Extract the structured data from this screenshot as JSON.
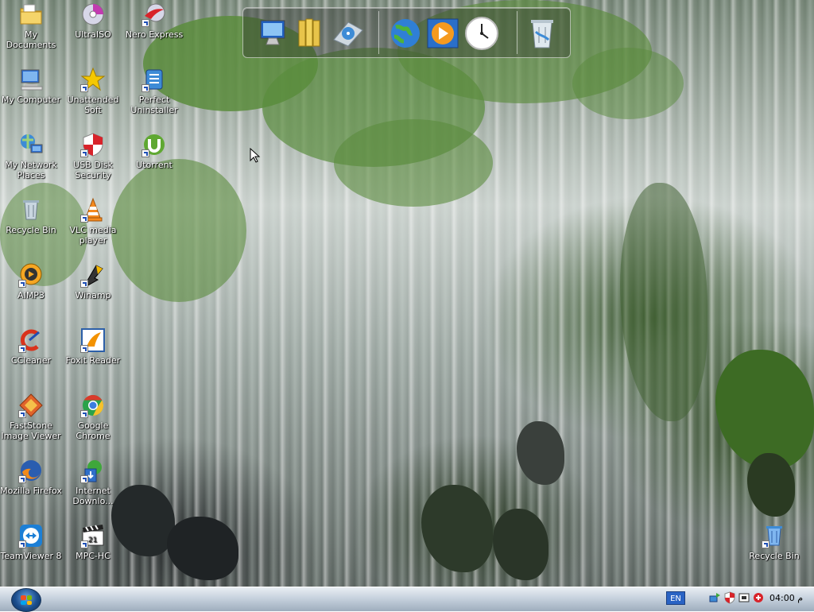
{
  "desktop_icons": [
    {
      "id": "my-documents",
      "label": "My Documents"
    },
    {
      "id": "ultraiso",
      "label": "UltraISO"
    },
    {
      "id": "nero-express",
      "label": "Nero Express"
    },
    {
      "id": "my-computer",
      "label": "My Computer"
    },
    {
      "id": "unattended-soft",
      "label": "Unattended Soft"
    },
    {
      "id": "perfect-uninstaller",
      "label": "Perfect Uninstaller"
    },
    {
      "id": "my-network-places",
      "label": "My Network Places"
    },
    {
      "id": "usb-disk-security",
      "label": "USB Disk Security"
    },
    {
      "id": "utorrent",
      "label": "Utorrent"
    },
    {
      "id": "recycle-bin",
      "label": "Recycle Bin"
    },
    {
      "id": "vlc-media-player",
      "label": "VLC media player"
    },
    {
      "id": "aimp3",
      "label": "AIMP3"
    },
    {
      "id": "winamp",
      "label": "Winamp"
    },
    {
      "id": "ccleaner",
      "label": "CCleaner"
    },
    {
      "id": "foxit-reader",
      "label": "Foxit Reader"
    },
    {
      "id": "faststone-image-viewer",
      "label": "FastStone Image Viewer"
    },
    {
      "id": "google-chrome",
      "label": "Google Chrome"
    },
    {
      "id": "mozilla-firefox",
      "label": "Mozilla Firefox"
    },
    {
      "id": "internet-download",
      "label": "Internet Downlo..."
    },
    {
      "id": "teamviewer-8",
      "label": "TeamViewer 8"
    },
    {
      "id": "mpc-hc",
      "label": "MPC-HC"
    },
    {
      "id": "recycle-bin-right",
      "label": "Recycle Bin"
    }
  ],
  "dock": {
    "items": [
      {
        "id": "computer",
        "icon": "monitor-icon"
      },
      {
        "id": "documents",
        "icon": "folder-icon"
      },
      {
        "id": "dvd",
        "icon": "dvd-drive-icon"
      },
      {
        "id": "internet",
        "icon": "globe-icon"
      },
      {
        "id": "media-player",
        "icon": "play-icon"
      },
      {
        "id": "clock",
        "icon": "clock-icon"
      },
      {
        "id": "recycle-bin",
        "icon": "trash-icon"
      }
    ]
  },
  "taskbar": {
    "language": "EN",
    "clock": "04:00 م"
  },
  "colors": {
    "taskbar_top": "#e9eef3",
    "taskbar_bottom": "#9eadbd",
    "lang_badge": "#2a63c4"
  }
}
